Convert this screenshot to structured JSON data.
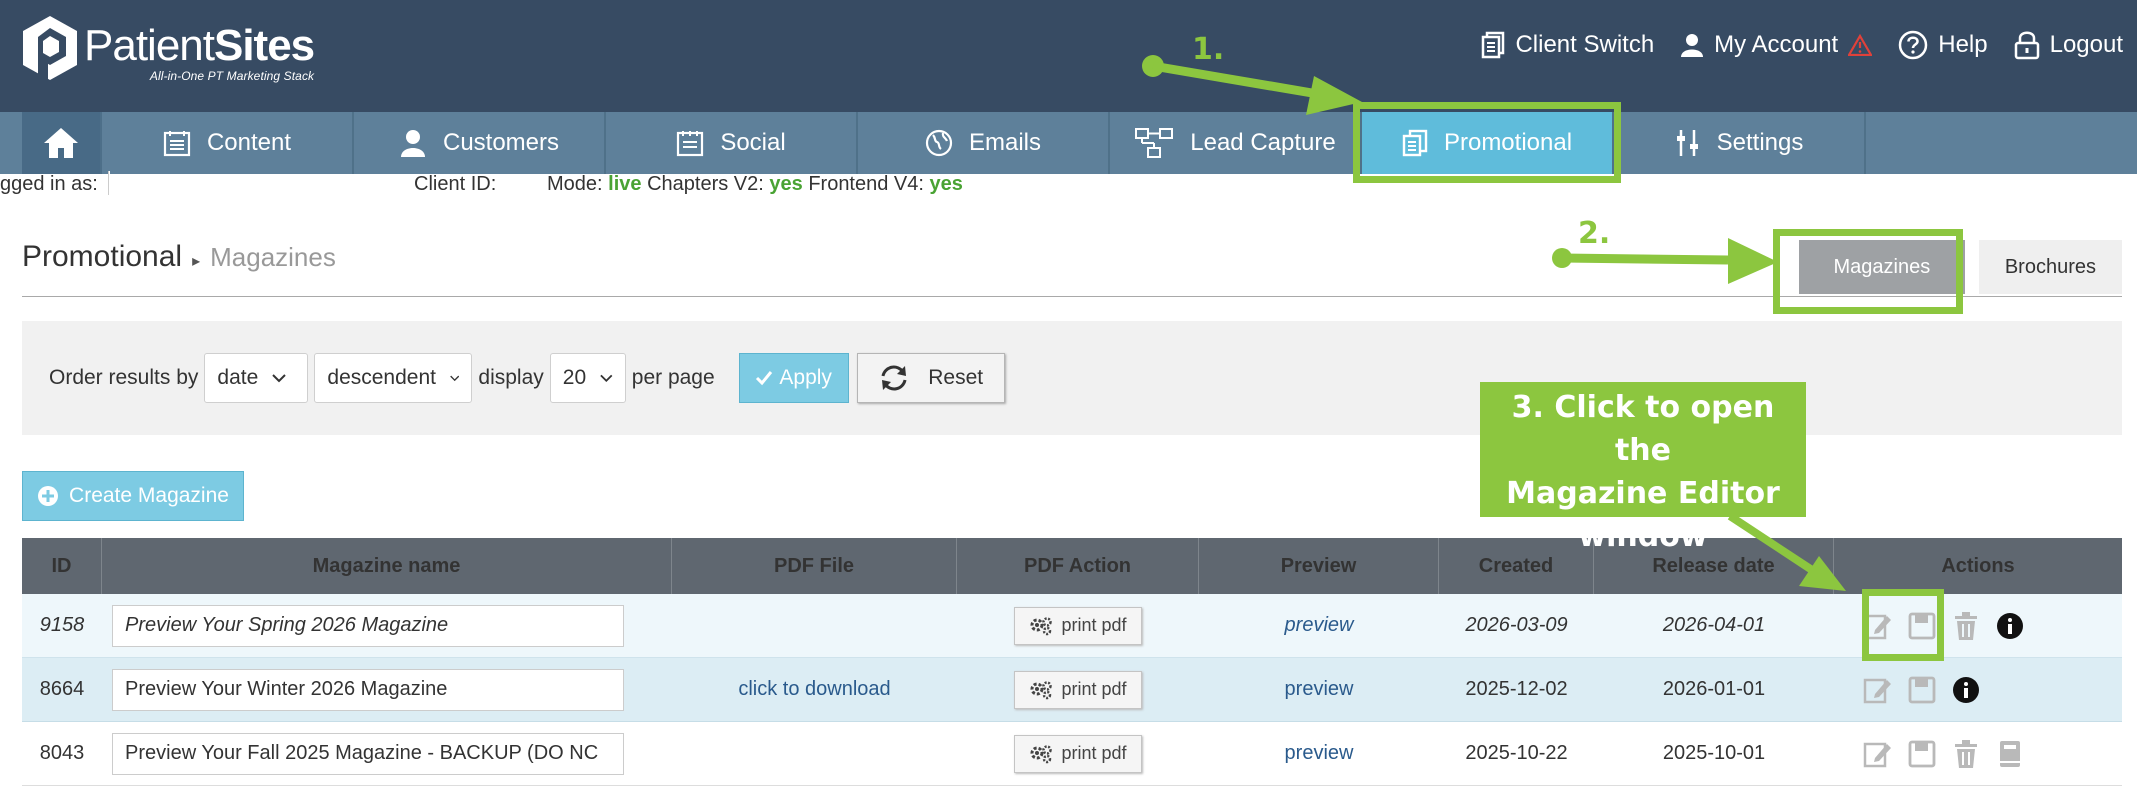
{
  "brand": {
    "name_part1": "Patient",
    "name_part2": "Sites",
    "tagline": "All-in-One PT Marketing Stack"
  },
  "top_links": [
    {
      "label": "Client Switch",
      "icon": "client-switch-icon"
    },
    {
      "label": "My Account",
      "icon": "user-icon",
      "alert": true
    },
    {
      "label": "Help",
      "icon": "help-icon"
    },
    {
      "label": "Logout",
      "icon": "lock-icon"
    }
  ],
  "nav": {
    "home_icon": "home-icon",
    "items": [
      {
        "label": "Content",
        "icon": "content-icon",
        "active": false
      },
      {
        "label": "Customers",
        "icon": "customers-icon",
        "active": false
      },
      {
        "label": "Social",
        "icon": "social-icon",
        "active": false
      },
      {
        "label": "Emails",
        "icon": "globe-icon",
        "active": false
      },
      {
        "label": "Lead Capture",
        "icon": "lead-capture-icon",
        "active": false
      },
      {
        "label": "Promotional",
        "icon": "promotional-icon",
        "active": true
      },
      {
        "label": "Settings",
        "icon": "settings-icon",
        "active": false
      }
    ]
  },
  "status": {
    "logged_in_label": "gged in as:",
    "client_id_label": "Client ID:",
    "mode_label": "Mode:",
    "mode_value": "live",
    "chapters_label": "Chapters V2:",
    "chapters_value": "yes",
    "frontend_label": "Frontend V4:",
    "frontend_value": "yes"
  },
  "page": {
    "title": "Promotional",
    "breadcrumb": "Magazines",
    "tabs": [
      {
        "label": "Magazines",
        "active": true
      },
      {
        "label": "Brochures",
        "active": false
      }
    ]
  },
  "filters": {
    "order_label": "Order results by",
    "order_by": "date",
    "direction": "descendent",
    "display_label": "display",
    "per_page_value": "20",
    "per_page_label": "per page",
    "apply_label": "Apply",
    "reset_label": "Reset"
  },
  "create_label": "Create Magazine",
  "table": {
    "columns": [
      "ID",
      "Magazine name",
      "PDF File",
      "PDF Action",
      "Preview",
      "Created",
      "Release date",
      "Actions"
    ],
    "print_label": "print pdf",
    "preview_label": "preview",
    "rows": [
      {
        "id": "9158",
        "name": "Preview Your Spring 2026 Magazine",
        "pdf": "",
        "created": "2026-03-09",
        "release": "2026-04-01",
        "actions": [
          "edit-icon",
          "save-icon",
          "trash-icon",
          "info-icon"
        ]
      },
      {
        "id": "8664",
        "name": "Preview Your Winter 2026 Magazine",
        "pdf": "click to download",
        "created": "2025-12-02",
        "release": "2026-01-01",
        "actions": [
          "edit-icon",
          "save-icon",
          "info-icon"
        ]
      },
      {
        "id": "8043",
        "name": "Preview Your Fall 2025 Magazine - BACKUP (DO NC",
        "pdf": "",
        "created": "2025-10-22",
        "release": "2025-10-01",
        "actions": [
          "edit-icon",
          "save-icon",
          "trash-icon",
          "book-icon"
        ]
      }
    ]
  },
  "annotations": {
    "step1": "1.",
    "step2": "2.",
    "callout_line1": "3. Click to open the",
    "callout_line2": "Magazine Editor",
    "callout_line3": "window",
    "color": "#8cc63f"
  },
  "colors": {
    "topbar": "#374b63",
    "navbar": "#5e809a",
    "nav_active": "#5fbcdb",
    "green_value": "#4aa334",
    "table_header": "#5f6770",
    "accent_button": "#7dcbe3"
  }
}
